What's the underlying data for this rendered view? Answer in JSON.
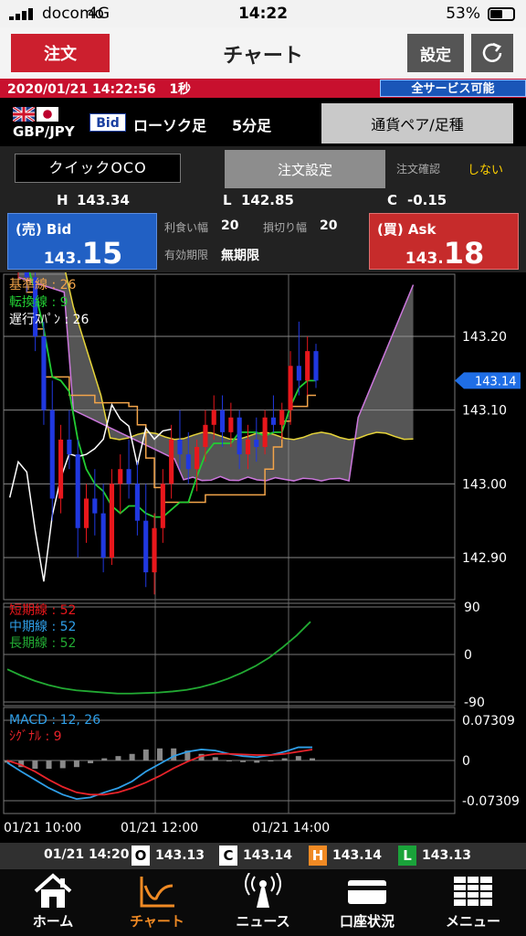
{
  "status": {
    "carrier": "docomo",
    "network": "4G",
    "time": "14:22",
    "battery": "53%"
  },
  "header": {
    "order_label": "注文",
    "title": "チャート",
    "settings_label": "設定"
  },
  "info": {
    "datetime": "2020/01/21 14:22:56",
    "interval": "1秒",
    "service_status": "全サービス可能"
  },
  "pair": {
    "name": "GBP/JPY",
    "price_type": "Bid",
    "chart_type": "ローソク足",
    "timeframe": "5分足",
    "select_label": "通貨ペア/足種"
  },
  "order": {
    "oco_label": "クイックOCO",
    "setting_label": "注文設定",
    "confirm_label": "注文確認",
    "confirm_value": "しない"
  },
  "stats": {
    "h_label": "H",
    "h_value": "143.34",
    "l_label": "L",
    "l_value": "142.85",
    "c_label": "C",
    "c_value": "-0.15"
  },
  "quote": {
    "bid_label": "(売) Bid",
    "bid_small": "143.",
    "bid_big": "15",
    "ask_label": "(買) Ask",
    "ask_small": "143.",
    "ask_big": "18",
    "take_profit_label": "利食い幅",
    "take_profit_value": "20",
    "stop_loss_label": "損切り幅",
    "stop_loss_value": "20",
    "expiry_label": "有効期限",
    "expiry_value": "無期限"
  },
  "colors": {
    "red": "#e8171c",
    "blue": "#2038e0",
    "kijun": "#f2a44a",
    "tenkan": "#22cc33",
    "chikou": "#ffffff",
    "span_a": "#e6d43a",
    "span_b": "#cc77dd",
    "cloud": "#9a9a9a",
    "macd": "#2f9fe8",
    "signal": "#e8232a",
    "current": "#1f6ee6"
  },
  "chart_data": {
    "main": {
      "type": "candlestick",
      "price_axis_ticks": [
        "143.20",
        "143.10",
        "143.00",
        "142.90"
      ],
      "current_price": "143.14",
      "legend": [
        {
          "label": "基準線 : 26",
          "color": "#f2a44a"
        },
        {
          "label": "転換線 : 9",
          "color": "#22cc33"
        },
        {
          "label": "遅行ｽﾊﾟﾝ : 26",
          "color": "#ffffff"
        }
      ],
      "candles": [
        [
          143.3,
          143.34,
          143.27,
          143.31
        ],
        [
          143.31,
          143.33,
          143.26,
          143.28
        ],
        [
          143.28,
          143.3,
          143.18,
          143.2
        ],
        [
          143.2,
          143.22,
          143.08,
          143.1
        ],
        [
          143.1,
          143.14,
          142.95,
          142.98
        ],
        [
          142.98,
          143.08,
          142.96,
          143.06
        ],
        [
          143.06,
          143.1,
          143.02,
          143.04
        ],
        [
          143.04,
          143.06,
          142.9,
          142.94
        ],
        [
          142.94,
          143.0,
          142.92,
          142.98
        ],
        [
          142.98,
          143.02,
          142.93,
          142.96
        ],
        [
          142.96,
          143.0,
          142.88,
          142.9
        ],
        [
          142.9,
          143.02,
          142.89,
          143.0
        ],
        [
          143.0,
          143.04,
          142.96,
          143.02
        ],
        [
          143.02,
          143.06,
          142.98,
          143.0
        ],
        [
          143.0,
          143.03,
          142.93,
          142.95
        ],
        [
          142.95,
          143.0,
          142.86,
          142.88
        ],
        [
          142.88,
          142.96,
          142.85,
          142.94
        ],
        [
          142.94,
          143.02,
          142.92,
          143.0
        ],
        [
          143.0,
          143.08,
          142.98,
          143.06
        ],
        [
          143.06,
          143.1,
          143.02,
          143.04
        ],
        [
          143.04,
          143.07,
          143.0,
          143.02
        ],
        [
          143.02,
          143.06,
          142.99,
          143.05
        ],
        [
          143.05,
          143.1,
          143.03,
          143.08
        ],
        [
          143.08,
          143.12,
          143.06,
          143.1
        ],
        [
          143.1,
          143.12,
          143.05,
          143.07
        ],
        [
          143.07,
          143.11,
          143.05,
          143.09
        ],
        [
          143.09,
          143.1,
          143.02,
          143.04
        ],
        [
          143.04,
          143.08,
          143.02,
          143.06
        ],
        [
          143.06,
          143.09,
          143.03,
          143.05
        ],
        [
          143.05,
          143.1,
          143.04,
          143.09
        ],
        [
          143.09,
          143.12,
          143.07,
          143.08
        ],
        [
          143.08,
          143.11,
          143.06,
          143.1
        ],
        [
          143.1,
          143.18,
          143.08,
          143.16
        ],
        [
          143.16,
          143.22,
          143.12,
          143.14
        ],
        [
          143.14,
          143.2,
          143.12,
          143.18
        ],
        [
          143.18,
          143.19,
          143.13,
          143.14
        ]
      ]
    },
    "ma_panel": {
      "type": "line",
      "axis_ticks": [
        "90",
        "0",
        "-90"
      ],
      "legend": [
        {
          "label": "短期線 : 52",
          "color": "#e8171c"
        },
        {
          "label": "中期線 : 52",
          "color": "#2f9fe8"
        },
        {
          "label": "長期線 : 52",
          "color": "#22aa33"
        }
      ],
      "values": [
        -28,
        -40,
        -50,
        -58,
        -64,
        -68,
        -70,
        -72,
        -74,
        -74,
        -73,
        -72,
        -70,
        -67,
        -62,
        -55,
        -46,
        -35,
        -22,
        -6,
        14,
        36,
        62
      ]
    },
    "macd_panel": {
      "type": "line",
      "axis_ticks": [
        "0.07309",
        "0",
        "-0.07309"
      ],
      "legend": [
        {
          "label": "MACD : 12, 26",
          "color": "#2f9fe8"
        },
        {
          "label": "ｼｸﾞﾅﾙ : 9",
          "color": "#e8232a"
        }
      ],
      "macd": [
        -0.004,
        -0.02,
        -0.035,
        -0.05,
        -0.062,
        -0.07,
        -0.067,
        -0.058,
        -0.05,
        -0.038,
        -0.02,
        -0.006,
        0.008,
        0.016,
        0.02,
        0.018,
        0.012,
        0.008,
        0.006,
        0.01,
        0.016,
        0.024,
        0.024
      ],
      "signal": [
        0.0,
        -0.008,
        -0.02,
        -0.035,
        -0.048,
        -0.058,
        -0.062,
        -0.062,
        -0.058,
        -0.05,
        -0.04,
        -0.028,
        -0.014,
        -0.002,
        0.008,
        0.012,
        0.012,
        0.011,
        0.01,
        0.01,
        0.012,
        0.016,
        0.02
      ]
    },
    "time_labels": [
      "01/21 10:00",
      "01/21 12:00",
      "01/21 14:00"
    ]
  },
  "ohlc": {
    "time": "01/21 14:20",
    "o_label": "O",
    "o_value": "143.13",
    "c_label": "C",
    "c_value": "143.14",
    "h_label": "H",
    "h_value": "143.14",
    "l_label": "L",
    "l_value": "143.13"
  },
  "tabs": [
    {
      "label": "ホーム"
    },
    {
      "label": "チャート"
    },
    {
      "label": "ニュース"
    },
    {
      "label": "口座状況"
    },
    {
      "label": "メニュー"
    }
  ]
}
